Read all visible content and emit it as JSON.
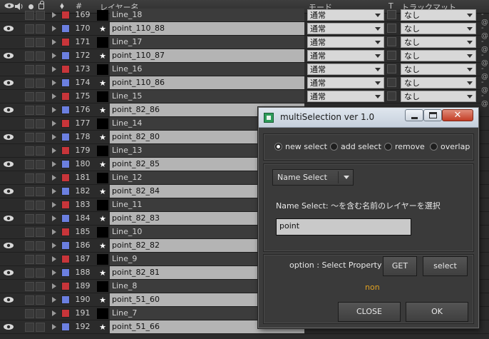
{
  "header": {
    "tag_icon": "⬧",
    "num_label": "#",
    "name_label": "レイヤー名",
    "mode_label": "モード",
    "t_label": "T",
    "track_label": "トラックマット"
  },
  "colors": {
    "label_blue": "#6b7fe0",
    "label_red": "#c8353a",
    "name_highlight": "#b4b4b4",
    "dialog_bg": "#3c3c3c",
    "accent_orange": "#e0a020"
  },
  "rows": [
    {
      "num": "169",
      "name": "Line_18",
      "label": "red",
      "eye": false,
      "type": "solid",
      "mode": "通常",
      "track": "なし"
    },
    {
      "num": "170",
      "name": "point_110_88",
      "label": "blue",
      "eye": true,
      "type": "star",
      "mode": "通常",
      "track": "なし"
    },
    {
      "num": "171",
      "name": "Line_17",
      "label": "red",
      "eye": false,
      "type": "solid",
      "mode": "通常",
      "track": "なし"
    },
    {
      "num": "172",
      "name": "point_110_87",
      "label": "blue",
      "eye": true,
      "type": "star",
      "mode": "通常",
      "track": "なし"
    },
    {
      "num": "173",
      "name": "Line_16",
      "label": "red",
      "eye": false,
      "type": "solid",
      "mode": "通常",
      "track": "なし"
    },
    {
      "num": "174",
      "name": "point_110_86",
      "label": "blue",
      "eye": true,
      "type": "star",
      "mode": "通常",
      "track": "なし"
    },
    {
      "num": "175",
      "name": "Line_15",
      "label": "red",
      "eye": false,
      "type": "solid",
      "mode": "通常",
      "track": "なし"
    },
    {
      "num": "176",
      "name": "point_82_86",
      "label": "blue",
      "eye": true,
      "type": "star",
      "mode": "",
      "track": ""
    },
    {
      "num": "177",
      "name": "Line_14",
      "label": "red",
      "eye": false,
      "type": "solid",
      "mode": "",
      "track": ""
    },
    {
      "num": "178",
      "name": "point_82_80",
      "label": "blue",
      "eye": true,
      "type": "star",
      "mode": "",
      "track": ""
    },
    {
      "num": "179",
      "name": "Line_13",
      "label": "red",
      "eye": false,
      "type": "solid",
      "mode": "",
      "track": ""
    },
    {
      "num": "180",
      "name": "point_82_85",
      "label": "blue",
      "eye": true,
      "type": "star",
      "mode": "",
      "track": ""
    },
    {
      "num": "181",
      "name": "Line_12",
      "label": "red",
      "eye": false,
      "type": "solid",
      "mode": "",
      "track": ""
    },
    {
      "num": "182",
      "name": "point_82_84",
      "label": "blue",
      "eye": true,
      "type": "star",
      "mode": "",
      "track": ""
    },
    {
      "num": "183",
      "name": "Line_11",
      "label": "red",
      "eye": false,
      "type": "solid",
      "mode": "",
      "track": ""
    },
    {
      "num": "184",
      "name": "point_82_83",
      "label": "blue",
      "eye": true,
      "type": "star",
      "mode": "",
      "track": ""
    },
    {
      "num": "185",
      "name": "Line_10",
      "label": "red",
      "eye": false,
      "type": "solid",
      "mode": "",
      "track": ""
    },
    {
      "num": "186",
      "name": "point_82_82",
      "label": "blue",
      "eye": true,
      "type": "star",
      "mode": "",
      "track": ""
    },
    {
      "num": "187",
      "name": "Line_9",
      "label": "red",
      "eye": false,
      "type": "solid",
      "mode": "",
      "track": ""
    },
    {
      "num": "188",
      "name": "point_82_81",
      "label": "blue",
      "eye": true,
      "type": "star",
      "mode": "",
      "track": ""
    },
    {
      "num": "189",
      "name": "Line_8",
      "label": "red",
      "eye": false,
      "type": "solid",
      "mode": "",
      "track": ""
    },
    {
      "num": "190",
      "name": "point_51_60",
      "label": "blue",
      "eye": true,
      "type": "star",
      "mode": "",
      "track": ""
    },
    {
      "num": "191",
      "name": "Line_7",
      "label": "red",
      "eye": false,
      "type": "solid",
      "mode": "",
      "track": ""
    },
    {
      "num": "192",
      "name": "point_51_66",
      "label": "blue",
      "eye": true,
      "type": "star",
      "mode": "",
      "track": ""
    }
  ],
  "dialog": {
    "title": "multiSelection ver 1.0",
    "radios": [
      {
        "label": "new select",
        "selected": true
      },
      {
        "label": "add select",
        "selected": false
      },
      {
        "label": "remove",
        "selected": false
      },
      {
        "label": "overlap",
        "selected": false
      }
    ],
    "select_value": "Name Select",
    "description": "Name Select: ～を含む名前のレイヤーを選択",
    "input_value": "point",
    "option_label": "option : Select Property",
    "get_label": "GET",
    "select_label": "select",
    "status": "non",
    "close_label": "CLOSE",
    "ok_label": "OK",
    "close_glyph": "✕"
  }
}
